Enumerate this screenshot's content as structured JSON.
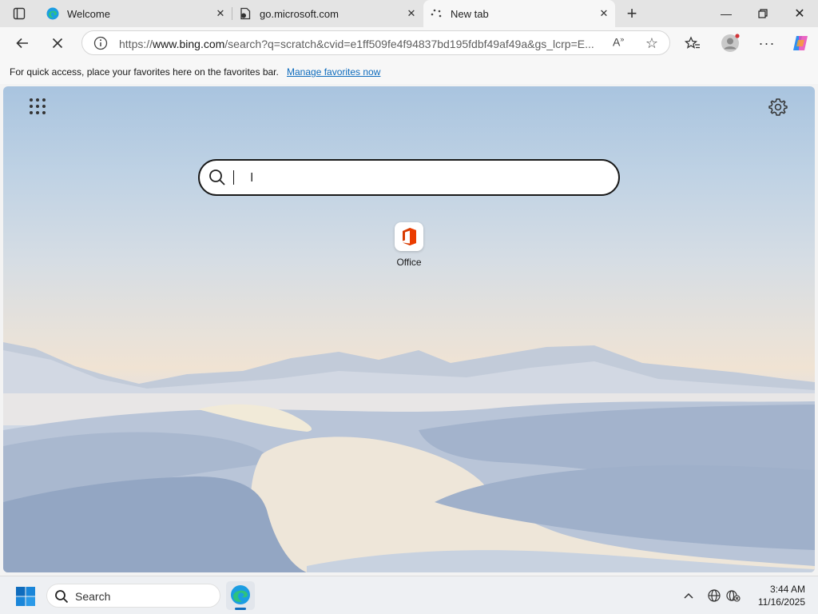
{
  "browser": {
    "tabs": [
      {
        "title": "Welcome",
        "favicon": "edge-icon",
        "active": false
      },
      {
        "title": "go.microsoft.com",
        "favicon": "page-icon",
        "active": false
      },
      {
        "title": "New tab",
        "favicon": "loading-icon",
        "active": true
      }
    ],
    "address": {
      "prefix": "https://",
      "host": "www.bing.com",
      "path": "/search?q=scratch&cvid=e1ff509fe4f94837bd195fdbf49af49a&gs_lcrp=E..."
    },
    "favorites_bar": {
      "message": "For quick access, place your favorites here on the favorites bar.",
      "link": "Manage favorites now"
    },
    "accent": "#0f6cbd"
  },
  "newtab": {
    "search": {
      "value": "",
      "placeholder": ""
    },
    "quick_links": [
      {
        "label": "Office",
        "icon": "office-icon"
      }
    ]
  },
  "taskbar": {
    "search_label": "Search",
    "time": "3:44 AM",
    "date": "11/16/2025"
  }
}
